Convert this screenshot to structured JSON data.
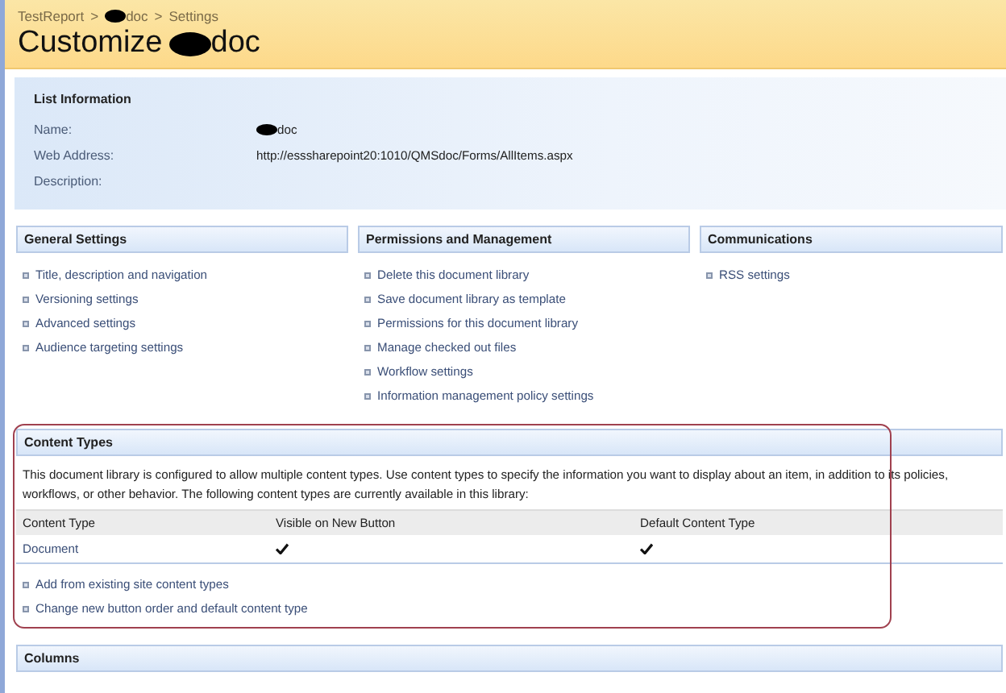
{
  "breadcrumb": {
    "items": [
      {
        "text": "TestReport"
      },
      {
        "text": "doc",
        "redacted": true
      },
      {
        "text": "Settings"
      }
    ],
    "separator": ">"
  },
  "page_title": {
    "prefix": "Customize",
    "name": "doc",
    "redacted": true
  },
  "list_information": {
    "heading": "List Information",
    "fields": [
      {
        "label": "Name:",
        "value": "doc",
        "redacted": true
      },
      {
        "label": "Web Address:",
        "value": "http://esssharepoint20:1010/QMSdoc/Forms/AllItems.aspx"
      },
      {
        "label": "Description:"
      }
    ]
  },
  "settings_groups": [
    {
      "heading": "General Settings",
      "links": [
        "Title, description and navigation",
        "Versioning settings",
        "Advanced settings",
        "Audience targeting settings"
      ]
    },
    {
      "heading": "Permissions and Management",
      "links": [
        "Delete this document library",
        "Save document library as template",
        "Permissions for this document library",
        "Manage checked out files",
        "Workflow settings",
        "Information management policy settings"
      ]
    },
    {
      "heading": "Communications",
      "links": [
        "RSS settings"
      ]
    }
  ],
  "content_types": {
    "heading": "Content Types",
    "highlighted": true,
    "description": "This document library is configured to allow multiple content types. Use content types to specify the information you want to display about an item, in addition to its policies, workflows, or other behavior. The following content types are currently available in this library:",
    "columns": [
      "Content Type",
      "Visible on New Button",
      "Default Content Type"
    ],
    "rows": [
      {
        "name": "Document",
        "visible_on_new_button": true,
        "default": true
      }
    ],
    "links": [
      "Add from existing site content types",
      "Change new button order and default content type"
    ]
  },
  "columns_section": {
    "heading": "Columns"
  }
}
